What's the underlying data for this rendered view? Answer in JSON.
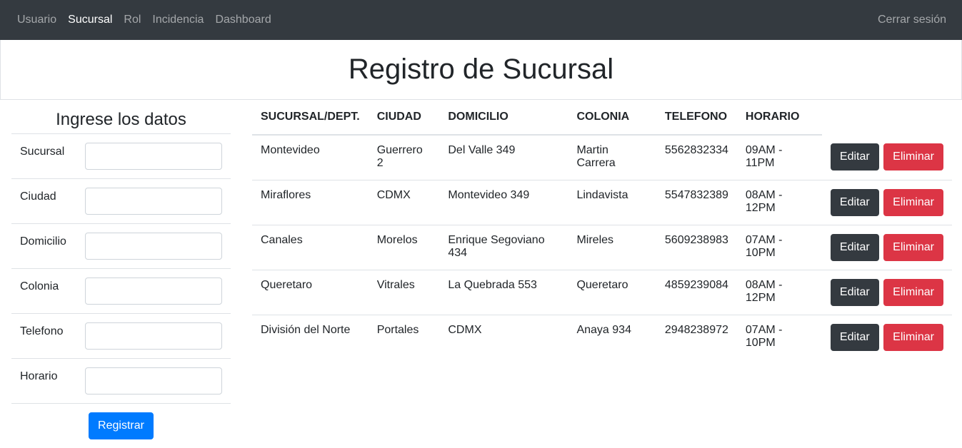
{
  "navbar": {
    "links": [
      {
        "label": "Usuario",
        "active": false
      },
      {
        "label": "Sucursal",
        "active": true
      },
      {
        "label": "Rol",
        "active": false
      },
      {
        "label": "Incidencia",
        "active": false
      },
      {
        "label": "Dashboard",
        "active": false
      }
    ],
    "logout_label": "Cerrar sesión"
  },
  "header": {
    "title": "Registro de Sucursal"
  },
  "form": {
    "title": "Ingrese los datos",
    "fields": [
      {
        "label": "Sucursal",
        "value": ""
      },
      {
        "label": "Ciudad",
        "value": ""
      },
      {
        "label": "Domicilio",
        "value": ""
      },
      {
        "label": "Colonia",
        "value": ""
      },
      {
        "label": "Telefono",
        "value": ""
      },
      {
        "label": "Horario",
        "value": ""
      }
    ],
    "submit_label": "Registrar"
  },
  "table": {
    "columns": [
      "SUCURSAL/DEPT.",
      "CIUDAD",
      "DOMICILIO",
      "COLONIA",
      "TELEFONO",
      "HORARIO"
    ],
    "edit_label": "Editar",
    "delete_label": "Eliminar",
    "rows": [
      [
        "Montevideo",
        "Guerrero 2",
        "Del Valle 349",
        "Martin Carrera",
        "5562832334",
        "09AM - 11PM"
      ],
      [
        "Miraflores",
        "CDMX",
        "Montevideo 349",
        "Lindavista",
        "5547832389",
        "08AM - 12PM"
      ],
      [
        "Canales",
        "Morelos",
        "Enrique Segoviano 434",
        "Mireles",
        "5609238983",
        "07AM - 10PM"
      ],
      [
        "Queretaro",
        "Vitrales",
        "La Quebrada 553",
        "Queretaro",
        "4859239084",
        "08AM - 12PM"
      ],
      [
        "División del Norte",
        "Portales",
        "CDMX",
        "Anaya 934",
        "2948238972",
        "07AM - 10PM"
      ]
    ]
  },
  "colors": {
    "navbar_bg": "#343a40",
    "primary": "#007bff",
    "danger": "#dc3545",
    "dark": "#343a40"
  }
}
